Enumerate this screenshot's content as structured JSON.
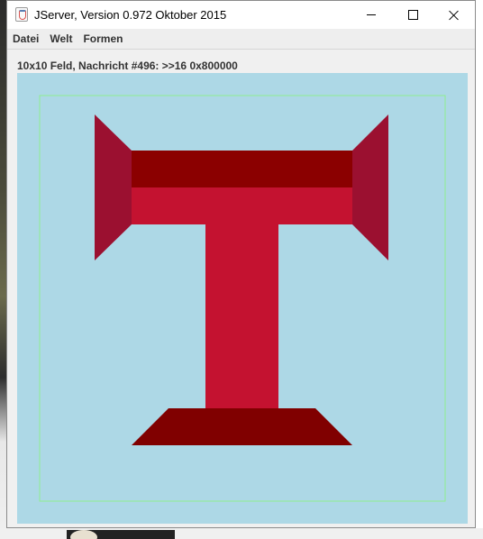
{
  "window": {
    "title": "JServer, Version 0.972 Oktober 2015"
  },
  "menubar": {
    "items": [
      {
        "label": "Datei"
      },
      {
        "label": "Welt"
      },
      {
        "label": "Formen"
      }
    ]
  },
  "status": {
    "text": "10x10 Feld, Nachricht #496: >>16 0x800000"
  },
  "board": {
    "background_color": "#add8e6",
    "grid_outline_color": "#90ee90",
    "shapes": [
      {
        "name": "left-wing",
        "color": "#9b1030"
      },
      {
        "name": "right-wing",
        "color": "#9b1030"
      },
      {
        "name": "crossbar-top",
        "color": "#8b0000"
      },
      {
        "name": "crossbar-bottom",
        "color": "#c41230"
      },
      {
        "name": "stem",
        "color": "#c41230"
      },
      {
        "name": "base",
        "color": "#800000"
      }
    ]
  }
}
